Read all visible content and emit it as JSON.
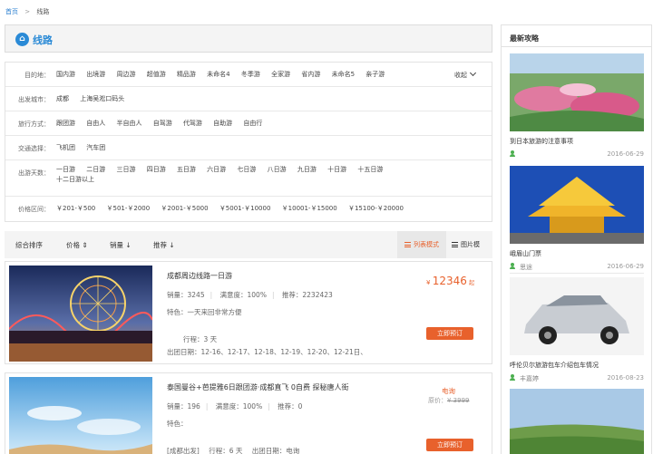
{
  "breadcrumb": {
    "home": "首页",
    "sep": ">",
    "current": "线路"
  },
  "header": {
    "title": "线路",
    "icon": "route-icon"
  },
  "filters": [
    {
      "label": "目的地：",
      "items": [
        "国内游",
        "出境游",
        "周边游",
        "超值游",
        "精品游",
        "未命名4",
        "冬季游",
        "全家游",
        "省内游",
        "未命名5",
        "亲子游"
      ],
      "collapse": "收起"
    },
    {
      "label": "出发城市：",
      "items": [
        "成都",
        "上海吴淞口码头"
      ]
    },
    {
      "label": "旅行方式：",
      "items": [
        "跟团游",
        "自由人",
        "半自由人",
        "自驾游",
        "代驾游",
        "自助游",
        "自由行"
      ]
    },
    {
      "label": "交通选择：",
      "items": [
        "飞机团",
        "汽车团"
      ]
    },
    {
      "label": "出游天数：",
      "items": [
        "一日游",
        "二日游",
        "三日游",
        "四日游",
        "五日游",
        "六日游",
        "七日游",
        "八日游",
        "九日游",
        "十日游",
        "十五日游",
        "十二日游以上"
      ]
    },
    {
      "label": "价格区间：",
      "items": [
        "￥201-￥500",
        "￥501-￥2000",
        "￥2001-￥5000",
        "￥5001-￥10000",
        "￥10001-￥15000",
        "￥15100-￥20000"
      ]
    }
  ],
  "sort": {
    "default": "综合排序",
    "price": "价格",
    "sales": "销量",
    "recommend": "推荐",
    "list_mode": "列表模式",
    "grid_mode": "图片模式"
  },
  "products": [
    {
      "title": "成都周边线路一日游",
      "sales": "销量：3245",
      "satisfaction": "满意度：100%",
      "recommend": "推荐：2232423",
      "feature": "特色：一天来回非常方便",
      "days": "行程：3 天",
      "dates": "出团日期：12-16、12-17、12-18、12-19、12-20、12-21日、",
      "price_symbol": "¥",
      "price": "12346",
      "price_suffix": "起",
      "book": "立即预订"
    },
    {
      "title": "泰国曼谷+芭提雅6日跟团游·成都直飞 0自费 探秘唐人街",
      "sales": "销量：196",
      "satisfaction": "满意度：100%",
      "recommend": "推荐：0",
      "feature": "特色：",
      "tag": "[成都出发]",
      "days": "行程：6 天",
      "dates": "出团日期：电询",
      "price": "电询",
      "orig_label": "原价：",
      "orig_price": "¥ 3999",
      "book": "立即预订"
    }
  ],
  "sidebar": {
    "title": "最新攻略",
    "items": [
      {
        "caption": "到日本旅游的注意事项",
        "user": "",
        "date": "2016-06-29"
      },
      {
        "caption": "峨眉山门票",
        "user": "思途",
        "date": "2016-06-29"
      },
      {
        "caption": "呼伦贝尔旅游包车介绍包车情况",
        "user": "丰嘉婷",
        "date": "2016-08-23"
      },
      {
        "caption": "",
        "user": "",
        "date": ""
      }
    ]
  },
  "colors": {
    "accent": "#e8612c",
    "link": "#2a7fd0",
    "header_icon": "#2a8ad6"
  }
}
